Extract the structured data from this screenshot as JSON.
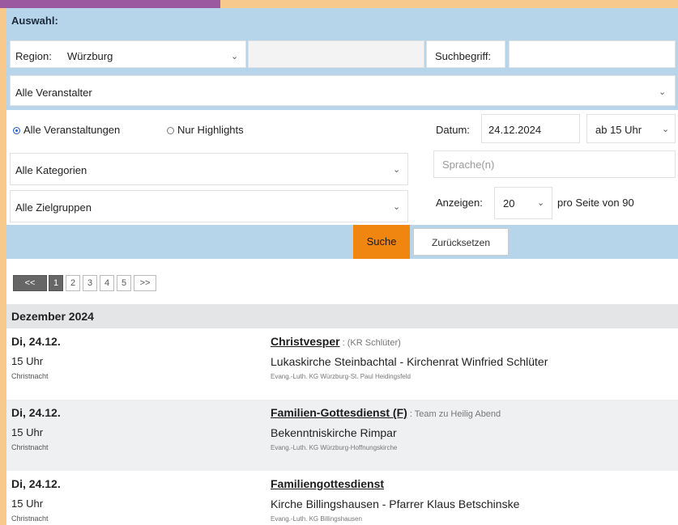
{
  "filter": {
    "header": "Auswahl:",
    "region_label": "Region:",
    "region_value": "Würzburg",
    "search_label": "Suchbegriff:",
    "organizer_value": "Alle Veranstalter",
    "radio_all": "Alle Veranstaltungen",
    "radio_highlights": "Nur Highlights",
    "date_label": "Datum:",
    "date_value": "24.12.2024",
    "time_value": "ab 15 Uhr",
    "language_placeholder": "Sprache(n)",
    "category_value": "Alle Kategorien",
    "audience_value": "Alle Zielgruppen",
    "show_label": "Anzeigen:",
    "per_page_value": "20",
    "per_page_suffix": "pro Seite von 90",
    "search_button": "Suche",
    "reset_button": "Zurücksetzen"
  },
  "pagination": {
    "first": "<<",
    "pages": [
      "1",
      "2",
      "3",
      "4",
      "5"
    ],
    "next": ">>",
    "current": "1"
  },
  "month_header": "Dezember 2024",
  "events": [
    {
      "date": "Di, 24.12.",
      "time": "15 Uhr",
      "category": "Christnacht",
      "title": "Christvesper",
      "extra": " : (KR Schlüter)",
      "place": "Lukaskirche Steinbachtal - Kirchenrat Winfried Schlüter",
      "organizer": "Evang.-Luth. KG Würzburg-St. Paul Heidingsfeld"
    },
    {
      "date": "Di, 24.12.",
      "time": "15 Uhr",
      "category": "Christnacht",
      "title": "Familien-Gottesdienst (F)",
      "extra": " : Team zu Heilig Abend",
      "place": "Bekenntniskirche Rimpar",
      "organizer": "Evang.-Luth. KG Würzburg-Hoffnungskirche"
    },
    {
      "date": "Di, 24.12.",
      "time": "15 Uhr",
      "category": "Christnacht",
      "title": "Familiengottesdienst",
      "extra": "",
      "place": "Kirche Billingshausen - Pfarrer Klaus Betschinske",
      "organizer": "Evang.-Luth. KG Billingshausen"
    }
  ],
  "colors": {
    "accent": "#f0850f",
    "header_blue": "#b6d5ea",
    "page_bg": "#f8c98c",
    "brand_purple": "#9b5aa0"
  }
}
